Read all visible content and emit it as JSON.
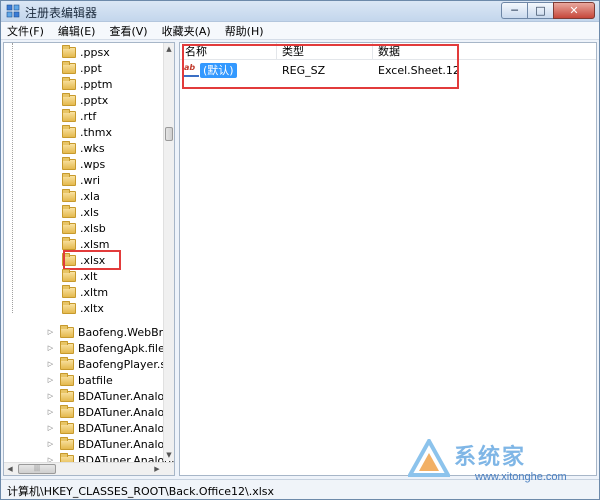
{
  "window": {
    "title": "注册表编辑器",
    "minimize_glyph": "─",
    "maximize_glyph": "□",
    "close_glyph": "✕"
  },
  "menu": [
    {
      "label": "文件(F)"
    },
    {
      "label": "编辑(E)"
    },
    {
      "label": "查看(V)"
    },
    {
      "label": "收藏夹(A)"
    },
    {
      "label": "帮助(H)"
    }
  ],
  "tree": {
    "extensions": [
      ".ppsx",
      ".ppt",
      ".pptm",
      ".pptx",
      ".rtf",
      ".thmx",
      ".wks",
      ".wps",
      ".wri",
      ".xla",
      ".xls",
      ".xlsb",
      ".xlsm",
      ".xlsx",
      ".xlt",
      ".xltm",
      ".xltx"
    ],
    "highlighted_extension": ".xlsx",
    "keys": [
      "Baofeng.WebBrow",
      "BaofengApk.file",
      "BaofengPlayer.sup",
      "batfile",
      "BDATuner.AnalogA",
      "BDATuner.AnalogA",
      "BDATuner.AnalogL",
      "BDATuner.AnalogL",
      "BDATuner.AnalogR"
    ]
  },
  "list": {
    "columns": {
      "name": "名称",
      "type": "类型",
      "data": "数据"
    },
    "rows": [
      {
        "name": "(默认)",
        "type": "REG_SZ",
        "data": "Excel.Sheet.12",
        "icon": "ab-string-icon"
      }
    ]
  },
  "status": {
    "path": "计算机\\HKEY_CLASSES_ROOT\\Back.Office12\\.xlsx"
  },
  "watermark": {
    "title": "系统家",
    "url": "www.xitonghe.com"
  },
  "colors": {
    "highlight_red": "#e23b3b",
    "selection_blue": "#3399ff"
  }
}
